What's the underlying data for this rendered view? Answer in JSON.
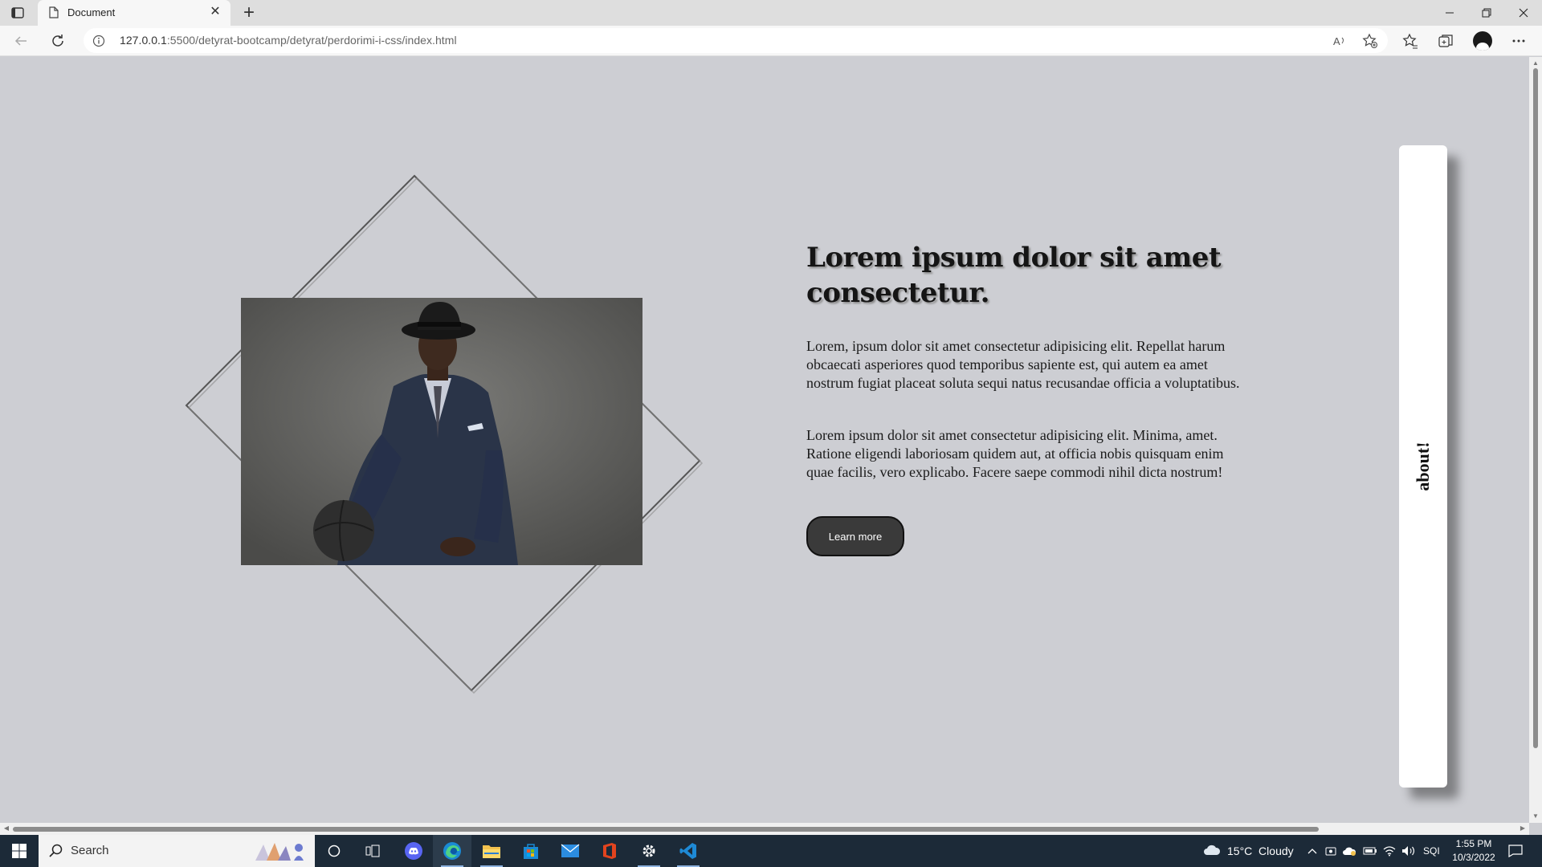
{
  "browser": {
    "tab_title": "Document",
    "new_tab": "+",
    "tab_close": "✕",
    "url_host": "127.0.0.1",
    "url_rest": ":5500/detyrat-bootcamp/detyrat/perdorimi-i-css/index.html"
  },
  "page": {
    "heading": "Lorem ipsum dolor sit amet consectetur.",
    "paragraph_1": "Lorem, ipsum dolor sit amet consectetur adipisicing elit. Repellat harum obcaecati asperiores quod temporibus sapiente est, qui autem ea amet nostrum fugiat placeat soluta sequi natus recusandae officia a voluptatibus.",
    "paragraph_2": "Lorem ipsum dolor sit amet consectetur adipisicing elit. Minima, amet. Ratione eligendi laboriosam quidem aut, at officia nobis quisquam enim quae facilis, vero explicabo. Facere saepe commodi nihil dicta nostrum!",
    "button_label": "Learn more",
    "side_label": "about!",
    "colors": {
      "background": "#cdced3",
      "heading": "#151515",
      "button": "#3a3a3a",
      "panel": "#ffffff"
    }
  },
  "taskbar": {
    "search_text": "Search",
    "weather": "15°C  Cloudy",
    "language": "SQI",
    "time": "1:55 PM",
    "date": "10/3/2022",
    "apps": [
      "task-view-icon",
      "discord-icon",
      "edge-icon",
      "file-explorer-icon",
      "store-icon",
      "mail-icon",
      "office-icon",
      "settings-icon",
      "vscode-icon"
    ]
  }
}
